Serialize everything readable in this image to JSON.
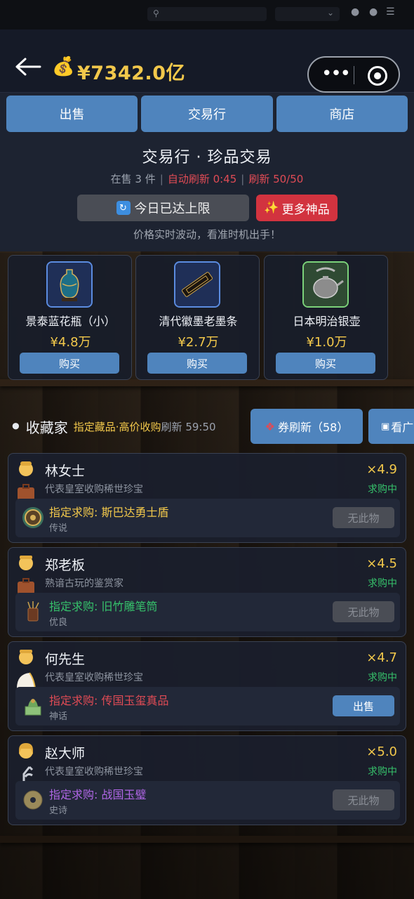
{
  "header": {
    "balance": "¥7342.0亿"
  },
  "tabs": [
    "出售",
    "交易行",
    "商店"
  ],
  "market": {
    "title": "交易行 · 珍品交易",
    "on_sale": "在售 3 件",
    "auto_refresh": "自动刷新 0:45",
    "refresh_count": "刷新 50/50",
    "limit_label": "今日已达上限",
    "more_label": "更多神品",
    "hint": "价格实时波动，看准时机出手！"
  },
  "goods": [
    {
      "name": "景泰蓝花瓶（小）",
      "price": "¥4.8万",
      "buy": "购买",
      "icon": "vase-icon"
    },
    {
      "name": "清代徽墨老墨条",
      "price": "¥2.7万",
      "buy": "购买",
      "icon": "ink-stick-icon"
    },
    {
      "name": "日本明治银壶",
      "price": "¥1.0万",
      "buy": "购买",
      "icon": "teapot-icon"
    }
  ],
  "collectors": {
    "title": "收藏家",
    "subtitle": "指定藏品·高价收购",
    "timer": "刷新 59:50",
    "coupon_label": "券刷新（58）",
    "ad_label": "看广",
    "list": [
      {
        "name": "林女士",
        "desc": "代表皇室收购稀世珍宝",
        "mult": "×4.9",
        "status": "求购中",
        "request": "指定求购: 斯巴达勇士盾",
        "rarity": "传说",
        "action": "无此物",
        "rarity_class": "r-legend",
        "action_class": "disabled",
        "avatar": "woman-briefcase-icon",
        "item_icon": "shield-icon"
      },
      {
        "name": "郑老板",
        "desc": "熟谙古玩的鉴赏家",
        "mult": "×4.5",
        "status": "求购中",
        "request": "指定求购: 旧竹雕笔筒",
        "rarity": "优良",
        "action": "无此物",
        "rarity_class": "r-good",
        "action_class": "disabled",
        "avatar": "man-briefcase-icon",
        "item_icon": "brush-pot-icon"
      },
      {
        "name": "何先生",
        "desc": "代表皇室收购稀世珍宝",
        "mult": "×4.7",
        "status": "求购中",
        "request": "指定求购: 传国玉玺真品",
        "rarity": "神话",
        "action": "出售",
        "rarity_class": "r-myth",
        "action_class": "sell",
        "avatar": "man-chef-icon",
        "item_icon": "jade-seal-icon"
      },
      {
        "name": "赵大师",
        "desc": "代表皇室收购稀世珍宝",
        "mult": "×5.0",
        "status": "求购中",
        "request": "指定求购: 战国玉璧",
        "rarity": "史诗",
        "action": "无此物",
        "rarity_class": "r-epic",
        "action_class": "disabled",
        "avatar": "scientist-icon",
        "item_icon": "jade-disc-icon"
      }
    ]
  }
}
